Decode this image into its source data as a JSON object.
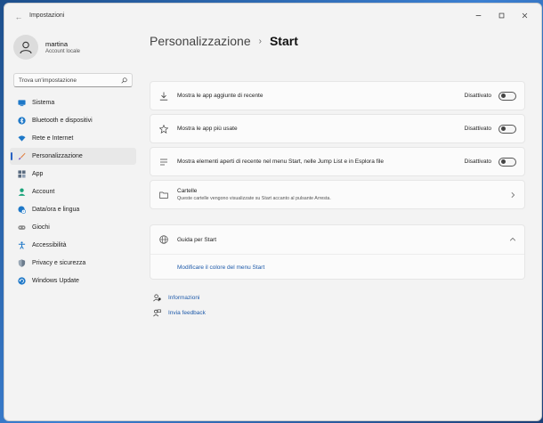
{
  "window": {
    "title": "Impostazioni"
  },
  "profile": {
    "name": "martina",
    "account_type": "Account locale"
  },
  "search": {
    "placeholder": "Trova un'impostazione"
  },
  "sidebar": {
    "items": [
      {
        "label": "Sistema",
        "icon": "monitor-icon",
        "color": "#1e78c8"
      },
      {
        "label": "Bluetooth e dispositivi",
        "icon": "bluetooth-icon",
        "color": "#1e78c8"
      },
      {
        "label": "Rete e Internet",
        "icon": "wifi-icon",
        "color": "#1e78c8"
      },
      {
        "label": "Personalizzazione",
        "icon": "brush-icon",
        "color": "#e07b39",
        "active": true
      },
      {
        "label": "App",
        "icon": "apps-icon",
        "color": "#5a6b80"
      },
      {
        "label": "Account",
        "icon": "person-icon",
        "color": "#1aa37a"
      },
      {
        "label": "Data/ora e lingua",
        "icon": "globe-clock-icon",
        "color": "#1e78c8"
      },
      {
        "label": "Giochi",
        "icon": "gamepad-icon",
        "color": "#888888"
      },
      {
        "label": "Accessibilità",
        "icon": "accessibility-icon",
        "color": "#1e78c8"
      },
      {
        "label": "Privacy e sicurezza",
        "icon": "shield-icon",
        "color": "#6b7b8c"
      },
      {
        "label": "Windows Update",
        "icon": "update-icon",
        "color": "#1e78c8"
      }
    ]
  },
  "breadcrumb": {
    "parent": "Personalizzazione",
    "separator": "›",
    "current": "Start"
  },
  "settings": [
    {
      "label": "Mostra le app aggiunte di recente",
      "state": "Disattivato",
      "icon": "download-icon"
    },
    {
      "label": "Mostra le app più usate",
      "state": "Disattivato",
      "icon": "star-icon"
    },
    {
      "label": "Mostra elementi aperti di recente nel menu Start, nelle Jump List e in Esplora file",
      "state": "Disattivato",
      "icon": "list-icon"
    }
  ],
  "folders": {
    "label": "Cartelle",
    "description": "Queste cartelle vengono visualizzate su Start accanto al pulsante Arresta.",
    "icon": "folder-icon"
  },
  "help": {
    "title": "Guida per Start",
    "link": "Modificare il colore del menu Start",
    "icon": "globe-icon"
  },
  "footer": {
    "info": "Informazioni",
    "feedback": "Invia feedback"
  },
  "colors": {
    "accent": "#2a63c4",
    "link": "#1f5baa",
    "window_bg": "#f3f3f3"
  }
}
